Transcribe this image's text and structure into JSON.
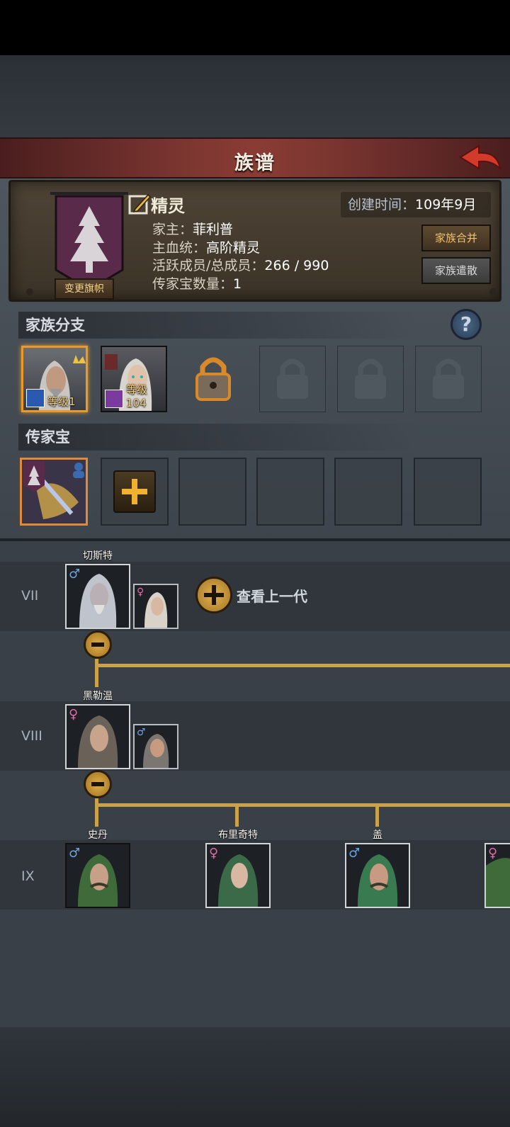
{
  "title": "族谱",
  "header": {
    "family_name": "精灵",
    "created_label": "创建时间：",
    "created_value": "109年9月",
    "head_label": "家主：",
    "head_value": "菲利普",
    "bloodline_label": "主血统：",
    "bloodline_value": "高阶精灵",
    "members_label": "活跃成员/总成员：",
    "members_value": "266 / 990",
    "heirloom_count_label": "传家宝数量：",
    "heirloom_count_value": "1",
    "change_flag_label": "变更旗帜",
    "merge_label": "家族合并",
    "disband_label": "家族遣散",
    "banner_color": "#5a2a4a"
  },
  "branches": {
    "title": "家族分支",
    "help_symbol": "?",
    "items": [
      {
        "level_text": "等级1",
        "active": true,
        "crown": true
      },
      {
        "level_text": "等级104",
        "active": false,
        "crown": false
      }
    ],
    "locked_count": 4
  },
  "heirlooms": {
    "title": "传家宝",
    "add_symbol": "+"
  },
  "tree": {
    "view_prev_label": "查看上一代",
    "generations": [
      {
        "label": "VII",
        "members": [
          {
            "name": "切斯特",
            "gender": "♂"
          }
        ],
        "spouse_gender": "♀"
      },
      {
        "label": "VIII",
        "members": [
          {
            "name": "黑勒温",
            "gender": "♀"
          }
        ],
        "spouse_gender": "♂"
      },
      {
        "label": "IX",
        "members": [
          {
            "name": "史丹",
            "gender": "♂"
          },
          {
            "name": "布里奇特",
            "gender": "♀"
          },
          {
            "name": "盖",
            "gender": "♂"
          },
          {
            "name": "",
            "gender": "♀"
          }
        ]
      }
    ]
  },
  "colors": {
    "accent_gold": "#caa24a",
    "title_red": "#7a3530",
    "male": "#6ba3e0",
    "female": "#e26aa8"
  }
}
